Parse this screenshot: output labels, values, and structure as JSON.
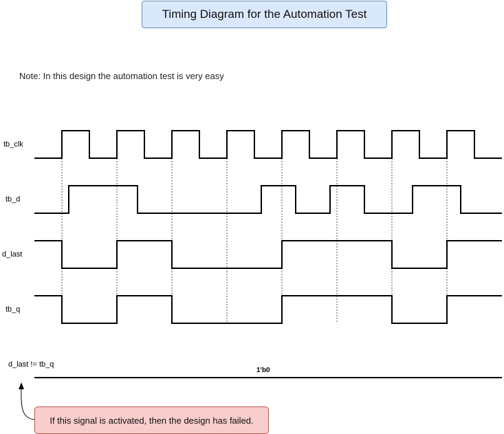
{
  "title": "Timing Diagram for the Automation Test",
  "note": "Note: In this design the automation test is very easy",
  "signals": [
    {
      "name": "tb_clk"
    },
    {
      "name": "tb_d"
    },
    {
      "name": "d_last"
    },
    {
      "name": "tb_q"
    }
  ],
  "compare_signal": {
    "name": "d_last != tb_q",
    "value": "1'b0"
  },
  "callout": "If this signal is activated, then the design has failed."
}
